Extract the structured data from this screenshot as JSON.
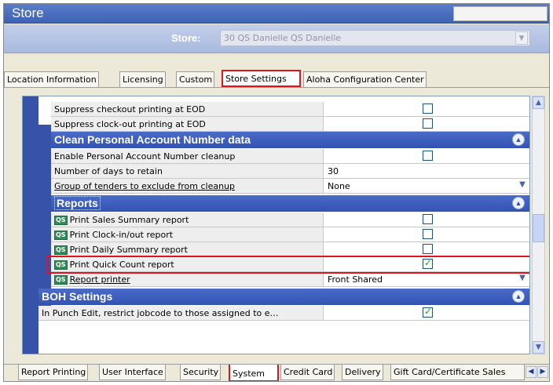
{
  "window": {
    "title": "Store"
  },
  "store": {
    "label": "Store:",
    "value": "30 QS Danielle QS Danielle"
  },
  "tabs": [
    "Location Information",
    "Licensing",
    "Custom",
    "Store Settings",
    "Aloha Configuration Center"
  ],
  "active_tab": "Store Settings",
  "rows": {
    "suppress_checkout": {
      "label": "Suppress checkout printing at EOD",
      "checked": false
    },
    "suppress_clockout": {
      "label": "Suppress clock-out printing at EOD",
      "checked": false
    },
    "enable_pan_cleanup": {
      "label": "Enable Personal Account Number cleanup",
      "checked": false
    },
    "days_retain": {
      "label": "Number of days to retain",
      "value": "30"
    },
    "group_tenders": {
      "label": "Group of tenders to exclude from cleanup",
      "value": "None"
    },
    "print_sales": {
      "label": "Print Sales Summary report",
      "checked": false
    },
    "print_clock": {
      "label": "Print Clock-in/out report",
      "checked": false
    },
    "print_daily": {
      "label": "Print Daily Summary report",
      "checked": false
    },
    "print_quick": {
      "label": "Print Quick Count report",
      "checked": true
    },
    "report_printer": {
      "label": "Report printer",
      "value": "Front Shared"
    },
    "punch_edit": {
      "label": "In Punch Edit, restrict jobcode to those assigned to e…",
      "checked": true
    }
  },
  "sections": {
    "clean_pan": "Clean Personal Account Number data",
    "reports": "Reports",
    "boh": "BOH Settings"
  },
  "qs_badge": "QS",
  "bottom_tabs": [
    "Report Printing",
    "User Interface",
    "Security",
    "System",
    "Credit Card",
    "Delivery",
    "Gift Card/Certificate Sales"
  ],
  "active_bottom_tab": "System",
  "icons": {
    "collapse": "double-chevron-up-icon",
    "dropdown": "chevron-down-icon",
    "scroll_up": "chevron-up-icon",
    "scroll_down": "chevron-down-icon",
    "nav_prev": "chevron-left-icon",
    "nav_next": "chevron-right-icon"
  },
  "colors": {
    "accent": "#3752a9",
    "highlight": "#e0141e",
    "check": "#21a121"
  }
}
